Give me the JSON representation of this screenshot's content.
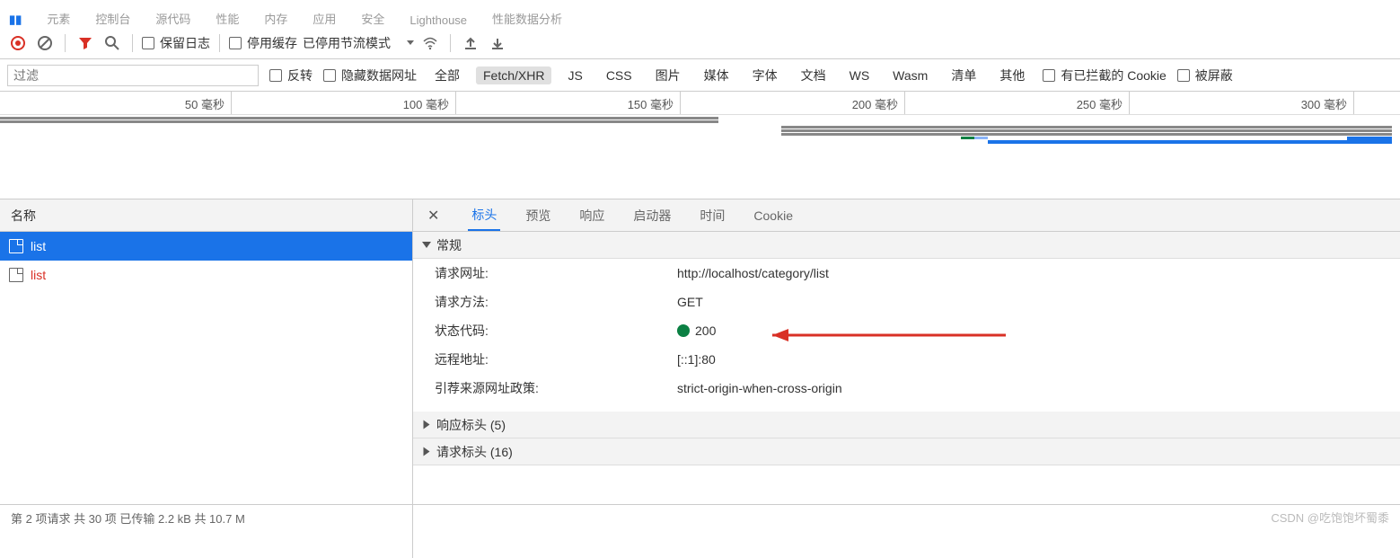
{
  "topTabs": [
    "元素",
    "控制台",
    "源代码",
    "性能",
    "内存",
    "应用",
    "安全",
    "Lighthouse",
    "性能数据分析"
  ],
  "toolbar": {
    "preserve_log": "保留日志",
    "disable_cache": "停用缓存",
    "throttling": "已停用节流模式"
  },
  "filter": {
    "placeholder": "过滤",
    "invert": "反转",
    "hide_data_urls": "隐藏数据网址",
    "types": [
      "全部",
      "Fetch/XHR",
      "JS",
      "CSS",
      "图片",
      "媒体",
      "字体",
      "文档",
      "WS",
      "Wasm",
      "清单",
      "其他"
    ],
    "active_type_index": 1,
    "blocked_cookies": "有已拦截的 Cookie",
    "blocked": "被屏蔽"
  },
  "timeline": {
    "ticks": [
      "50 毫秒",
      "100 毫秒",
      "150 毫秒",
      "200 毫秒",
      "250 毫秒",
      "300 毫秒"
    ]
  },
  "name_header": "名称",
  "requests": [
    {
      "name": "list",
      "selected": true,
      "pending": false
    },
    {
      "name": "list",
      "selected": false,
      "pending": true
    }
  ],
  "detail": {
    "tabs": [
      "标头",
      "预览",
      "响应",
      "启动器",
      "时间",
      "Cookie"
    ],
    "active_tab_index": 0,
    "general_title": "常规",
    "rows": {
      "request_url_label": "请求网址:",
      "request_url_value": "http://localhost/category/list",
      "request_method_label": "请求方法:",
      "request_method_value": "GET",
      "status_code_label": "状态代码:",
      "status_code_value": "200",
      "remote_addr_label": "远程地址:",
      "remote_addr_value": "[::1]:80",
      "referrer_policy_label": "引荐来源网址政策:",
      "referrer_policy_value": "strict-origin-when-cross-origin"
    },
    "response_headers_title": "响应标头 (5)",
    "request_headers_title": "请求标头 (16)"
  },
  "footer": {
    "text": "第 2 项请求   共 30 项   已传输 2.2 kB   共 10.7 M"
  },
  "watermark": "CSDN @吃饱饱坏蜀黍"
}
